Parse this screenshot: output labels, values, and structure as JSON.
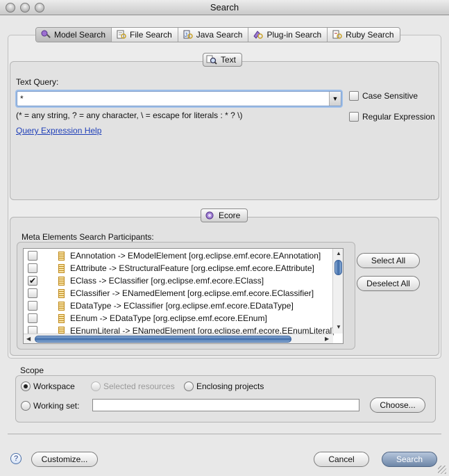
{
  "window": {
    "title": "Search"
  },
  "tabs": [
    {
      "label": "Model Search",
      "icon": "model-search-icon",
      "active": true
    },
    {
      "label": "File Search",
      "icon": "file-search-icon",
      "active": false
    },
    {
      "label": "Java Search",
      "icon": "java-search-icon",
      "active": false
    },
    {
      "label": "Plug-in Search",
      "icon": "plugin-search-icon",
      "active": false
    },
    {
      "label": "Ruby Search",
      "icon": "ruby-search-icon",
      "active": false
    }
  ],
  "text_section": {
    "header": "Text",
    "query_label": "Text Query:",
    "query_value": "*",
    "hint": "(* = any string, ? = any character, \\ = escape for literals : * ? \\)",
    "help_link": "Query Expression Help",
    "case_sensitive": {
      "label": "Case Sensitive",
      "checked": false
    },
    "regular_expression": {
      "label": "Regular Expression",
      "checked": false
    }
  },
  "ecore_section": {
    "header": "Ecore",
    "participants_label": "Meta Elements Search Participants:",
    "items": [
      {
        "label": "EAnnotation -> EModelElement [org.eclipse.emf.ecore.EAnnotation]",
        "checked": false
      },
      {
        "label": "EAttribute -> EStructuralFeature [org.eclipse.emf.ecore.EAttribute]",
        "checked": false
      },
      {
        "label": "EClass -> EClassifier [org.eclipse.emf.ecore.EClass]",
        "checked": true
      },
      {
        "label": "EClassifier -> ENamedElement [org.eclipse.emf.ecore.EClassifier]",
        "checked": false
      },
      {
        "label": "EDataType -> EClassifier [org.eclipse.emf.ecore.EDataType]",
        "checked": false
      },
      {
        "label": "EEnum -> EDataType [org.eclipse.emf.ecore.EEnum]",
        "checked": false
      },
      {
        "label": "EEnumLiteral -> ENamedElement [org.eclipse.emf.ecore.EEnumLiteral]",
        "checked": false
      }
    ],
    "select_all": "Select All",
    "deselect_all": "Deselect All"
  },
  "scope": {
    "label": "Scope",
    "workspace": {
      "label": "Workspace",
      "selected": true
    },
    "selected_resources": {
      "label": "Selected resources",
      "selected": false,
      "disabled": true
    },
    "enclosing_projects": {
      "label": "Enclosing projects",
      "selected": false
    },
    "working_set": {
      "label": "Working set:",
      "selected": false,
      "value": ""
    },
    "choose": "Choose..."
  },
  "footer": {
    "help": "?",
    "customize": "Customize...",
    "cancel": "Cancel",
    "search": "Search"
  }
}
